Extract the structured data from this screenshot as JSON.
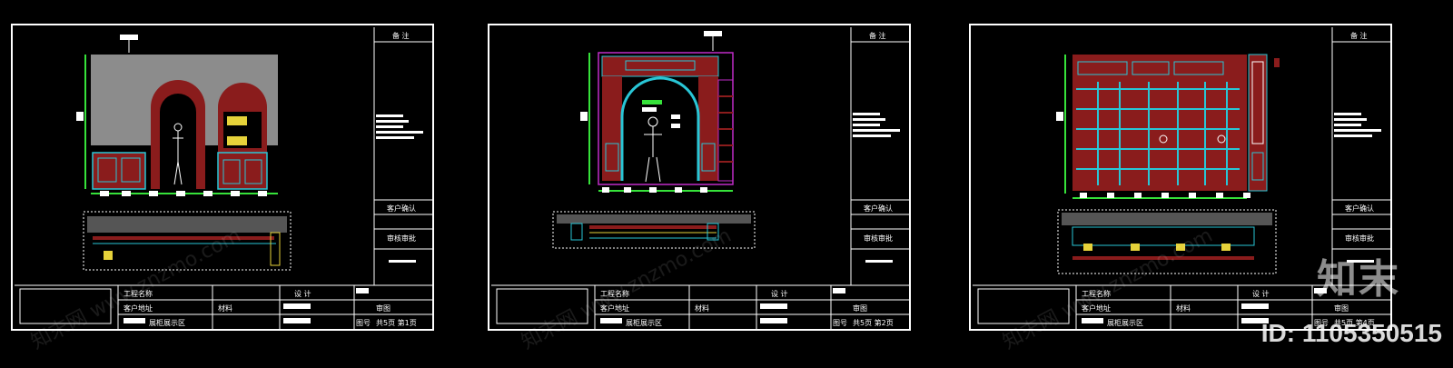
{
  "sheets": [
    {
      "remark": "备 注",
      "client_confirm": "客户确认",
      "approval": "审核审批",
      "project_name_label": "工程名称",
      "client_address": "客户地址",
      "drawing_name": "展柜展示区",
      "material": "材料",
      "design": "设 计",
      "review": "审图",
      "drawing_no": "图号",
      "sheet_count": "共5页 第1页"
    },
    {
      "remark": "备 注",
      "client_confirm": "客户确认",
      "approval": "审核审批",
      "project_name_label": "工程名称",
      "client_address": "客户地址",
      "drawing_name": "展柜展示区",
      "material": "材料",
      "design": "设 计",
      "review": "审图",
      "drawing_no": "图号",
      "sheet_count": "共5页 第2页"
    },
    {
      "remark": "备 注",
      "client_confirm": "客户确认",
      "approval": "审核审批",
      "project_name_label": "工程名称",
      "client_address": "客户地址",
      "drawing_name": "展柜展示区",
      "material": "材料",
      "design": "设 计",
      "review": "审图",
      "drawing_no": "图号",
      "sheet_count": "共5页 第4页"
    }
  ],
  "watermark": {
    "logo": "知末",
    "id_text": "ID: 1105350515",
    "diagonal": "知末网 www.znzmo.com"
  },
  "colors": {
    "wall_gray": "#8c8c8c",
    "frame_red": "#8a1c1c",
    "line_cyan": "#29c6d6",
    "line_green": "#36e23a",
    "line_yellow": "#e6d23a",
    "line_magenta": "#c02cc8"
  }
}
